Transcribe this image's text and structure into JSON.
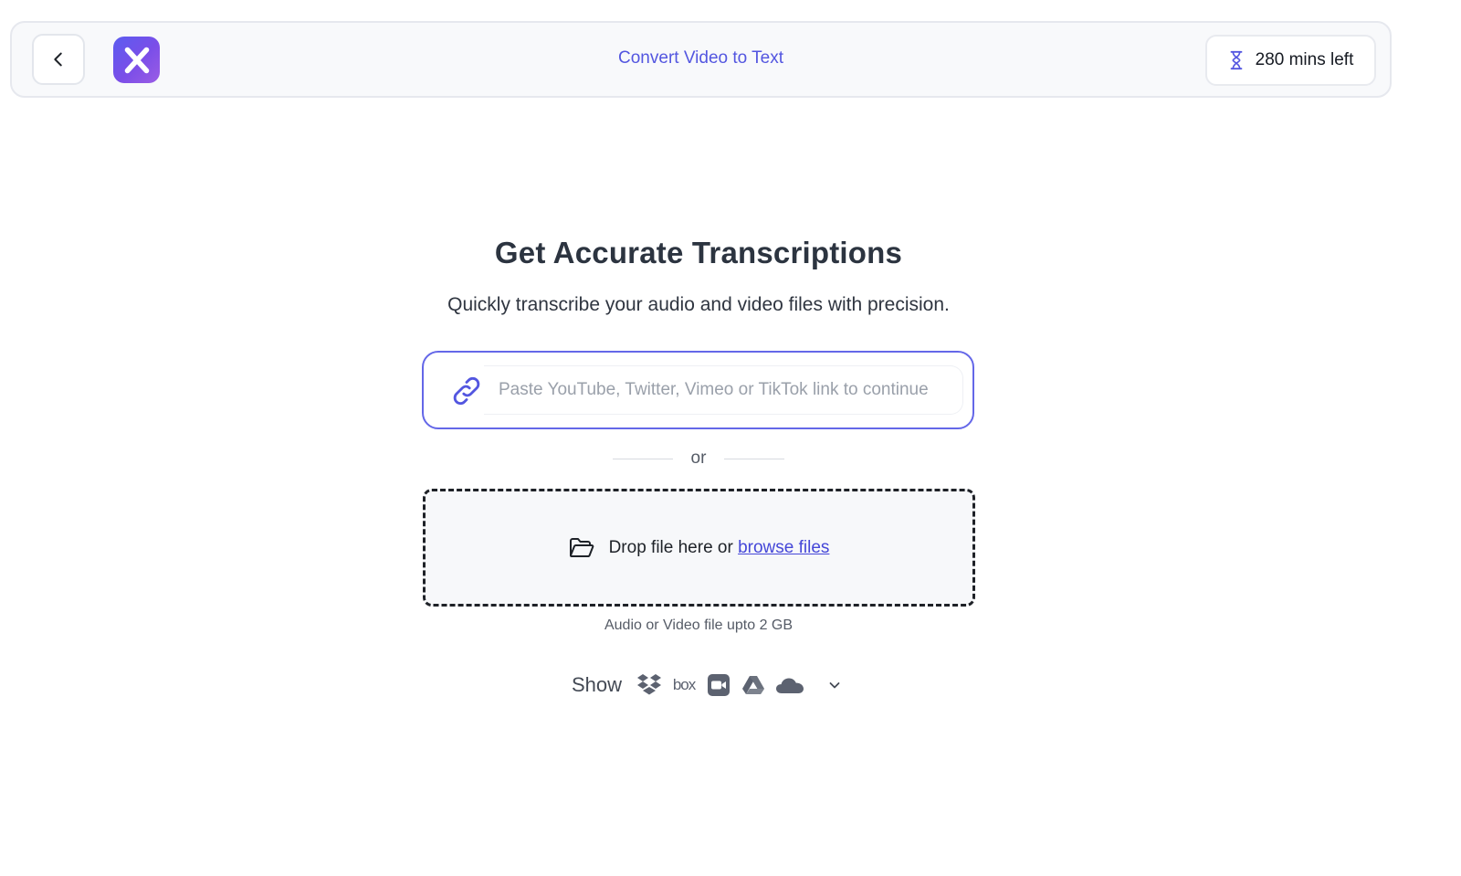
{
  "header": {
    "title": "Convert Video to Text",
    "mins_left": "280 mins left",
    "brand_color": "#5356e0"
  },
  "main": {
    "headline": "Get Accurate Transcriptions",
    "subline": "Quickly transcribe your audio and video files with precision.",
    "link_input": {
      "placeholder": "Paste YouTube, Twitter, Vimeo or TikTok link to continue",
      "value": ""
    },
    "or_text": "or",
    "drop_zone": {
      "prefix": "Drop file here or",
      "browse_label": "browse files"
    },
    "file_note": "Audio or Video file upto 2 GB",
    "sources": {
      "show_label": "Show",
      "items": [
        "dropbox-icon",
        "box-icon",
        "zoom-icon",
        "google-drive-icon",
        "onedrive-icon"
      ],
      "box_text": "box"
    }
  },
  "colors": {
    "accent": "#6467e8",
    "text_dark": "#2c3440",
    "link": "#4547d8"
  }
}
